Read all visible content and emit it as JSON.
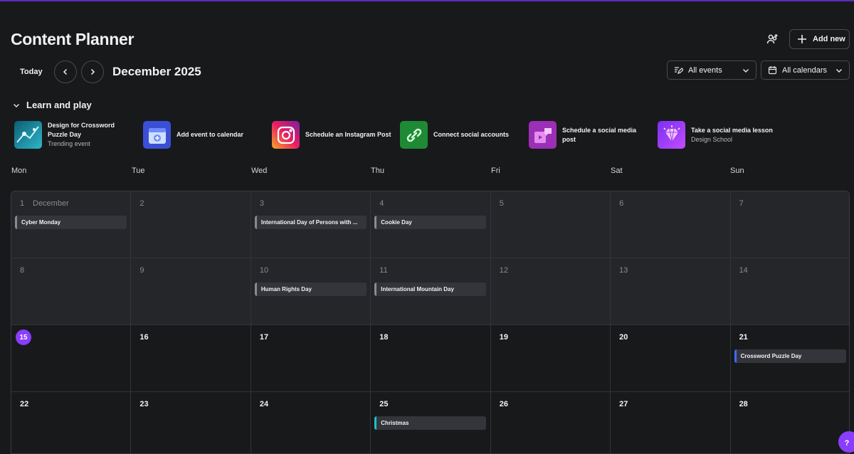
{
  "header": {
    "title": "Content Planner",
    "add_new_label": "Add new",
    "share_icon": "people-share-icon"
  },
  "toolbar": {
    "today_label": "Today",
    "month_label": "December 2025",
    "events_filter": "All events",
    "calendars_filter": "All calendars"
  },
  "learn": {
    "heading": "Learn and play",
    "cards": [
      {
        "title": "Design for Crossword Puzzle Day",
        "subtitle": "Trending event"
      },
      {
        "title": "Add event to calendar",
        "subtitle": ""
      },
      {
        "title": "Schedule an Instagram Post",
        "subtitle": ""
      },
      {
        "title": "Connect social accounts",
        "subtitle": ""
      },
      {
        "title": "Schedule a social media post",
        "subtitle": ""
      },
      {
        "title": "Take a social media lesson",
        "subtitle": "Design School"
      }
    ]
  },
  "weekdays": [
    "Mon",
    "Tue",
    "Wed",
    "Thu",
    "Fri",
    "Sat",
    "Sun"
  ],
  "calendar": {
    "first_cell_month": "December",
    "today": "15",
    "weeks": [
      {
        "days": [
          {
            "n": "1",
            "event": "Cyber Monday",
            "color": "#8a8b90"
          },
          {
            "n": "2"
          },
          {
            "n": "3",
            "event": "International Day of Persons with ...",
            "color": "#8a8b90"
          },
          {
            "n": "4",
            "event": "Cookie Day",
            "color": "#8a8b90"
          },
          {
            "n": "5"
          },
          {
            "n": "6"
          },
          {
            "n": "7"
          }
        ]
      },
      {
        "days": [
          {
            "n": "8"
          },
          {
            "n": "9"
          },
          {
            "n": "10",
            "event": "Human Rights Day",
            "color": "#8a8b90"
          },
          {
            "n": "11",
            "event": "International Mountain Day",
            "color": "#8a8b90"
          },
          {
            "n": "12"
          },
          {
            "n": "13"
          },
          {
            "n": "14"
          }
        ]
      },
      {
        "days": [
          {
            "n": "15"
          },
          {
            "n": "16"
          },
          {
            "n": "17"
          },
          {
            "n": "18"
          },
          {
            "n": "19"
          },
          {
            "n": "20"
          },
          {
            "n": "21",
            "event": "Crossword Puzzle Day",
            "color": "#3d6bff"
          }
        ]
      },
      {
        "days": [
          {
            "n": "22"
          },
          {
            "n": "23"
          },
          {
            "n": "24"
          },
          {
            "n": "25",
            "event": "Christmas",
            "color": "#19c3c7"
          },
          {
            "n": "26"
          },
          {
            "n": "27"
          },
          {
            "n": "28"
          }
        ]
      }
    ]
  },
  "help": {
    "label": "?"
  }
}
